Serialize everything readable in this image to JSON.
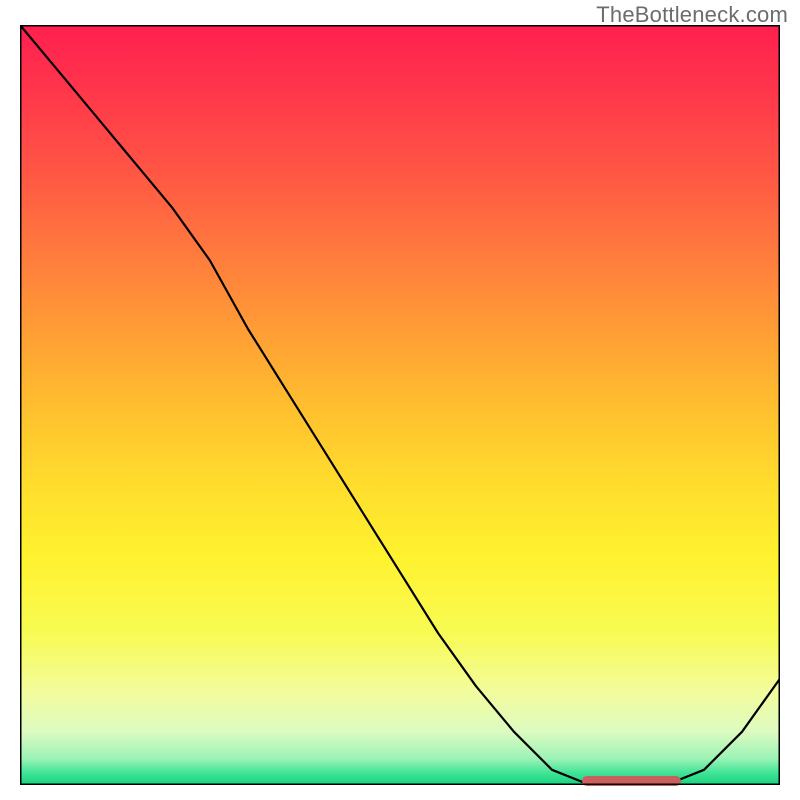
{
  "watermark": "TheBottleneck.com",
  "chart_data": {
    "type": "line",
    "title": "",
    "xlabel": "",
    "ylabel": "",
    "x": [
      0.0,
      0.05,
      0.1,
      0.15,
      0.2,
      0.25,
      0.3,
      0.35,
      0.4,
      0.45,
      0.5,
      0.55,
      0.6,
      0.65,
      0.7,
      0.75,
      0.8,
      0.85,
      0.9,
      0.95,
      1.0
    ],
    "values": [
      1.0,
      0.94,
      0.88,
      0.82,
      0.76,
      0.69,
      0.6,
      0.52,
      0.44,
      0.36,
      0.28,
      0.2,
      0.13,
      0.07,
      0.02,
      0.0,
      0.0,
      0.0,
      0.02,
      0.07,
      0.14
    ],
    "xlim": [
      0,
      1
    ],
    "ylim": [
      0,
      1
    ],
    "grid": false,
    "legend": false,
    "optimal_region": {
      "x_start": 0.74,
      "x_end": 0.87,
      "y": 0.005
    }
  },
  "gradient_stops": [
    {
      "offset": 0.0,
      "color": "#ff1f4f"
    },
    {
      "offset": 0.1,
      "color": "#ff3a4a"
    },
    {
      "offset": 0.2,
      "color": "#ff5844"
    },
    {
      "offset": 0.3,
      "color": "#ff7a3d"
    },
    {
      "offset": 0.4,
      "color": "#ff9c35"
    },
    {
      "offset": 0.5,
      "color": "#ffbe2f"
    },
    {
      "offset": 0.6,
      "color": "#ffdc2d"
    },
    {
      "offset": 0.7,
      "color": "#fff22f"
    },
    {
      "offset": 0.8,
      "color": "#f8fb53"
    },
    {
      "offset": 0.88,
      "color": "#f2fc9f"
    },
    {
      "offset": 0.93,
      "color": "#dcfbc0"
    },
    {
      "offset": 0.965,
      "color": "#9cf3b6"
    },
    {
      "offset": 0.985,
      "color": "#3de395"
    },
    {
      "offset": 1.0,
      "color": "#17d47e"
    }
  ],
  "colors": {
    "frame": "#000000",
    "line": "#000000",
    "marker": "#c9605d",
    "watermark": "#6c6c6c"
  }
}
